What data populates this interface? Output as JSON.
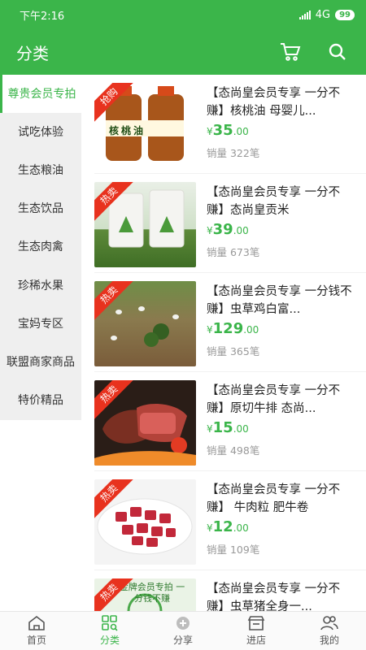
{
  "status": {
    "time": "下午2:16",
    "network": "4G",
    "battery": "99"
  },
  "header": {
    "title": "分类"
  },
  "sidebar": {
    "items": [
      {
        "label": "尊贵会员专拍",
        "active": true
      },
      {
        "label": "试吃体验"
      },
      {
        "label": "生态粮油"
      },
      {
        "label": "生态饮品"
      },
      {
        "label": "生态肉禽"
      },
      {
        "label": "珍稀水果"
      },
      {
        "label": "宝妈专区"
      },
      {
        "label": "联盟商家商品"
      },
      {
        "label": "特价精品"
      }
    ]
  },
  "products": [
    {
      "badge": "抢购",
      "name": "【态尚皇会员专享 一分不赚】核桃油 母婴儿...",
      "currency": "¥",
      "price_int": "35",
      "price_dec": ".00",
      "sales": "销量 322笔",
      "image_label": "核桃油"
    },
    {
      "badge": "热卖",
      "name": "【态尚皇会员专享 一分不赚】态尚皇贡米",
      "currency": "¥",
      "price_int": "39",
      "price_dec": ".00",
      "sales": "销量 673笔"
    },
    {
      "badge": "热卖",
      "name": "【态尚皇会员专享 一分钱不赚】虫草鸡白富...",
      "currency": "¥",
      "price_int": "129",
      "price_dec": ".00",
      "sales": "销量 365笔"
    },
    {
      "badge": "热卖",
      "name": "【态尚皇会员专享 一分不赚】原切牛排 态尚...",
      "currency": "¥",
      "price_int": "15",
      "price_dec": ".00",
      "sales": "销量 498笔"
    },
    {
      "badge": "热卖",
      "name": "【态尚皇会员专享 一分不赚】 牛肉粒 肥牛卷",
      "currency": "¥",
      "price_int": "12",
      "price_dec": ".00",
      "sales": "销量 109笔"
    },
    {
      "badge": "热卖",
      "name": "【态尚皇会员专享 一分不赚】虫草猪全身一...",
      "currency": "¥",
      "price_int": "",
      "price_dec": "",
      "sales": "",
      "image_label": "金牌会员专拍 一分钱不赚"
    }
  ],
  "tabbar": {
    "items": [
      {
        "label": "首页",
        "icon": "home-icon"
      },
      {
        "label": "分类",
        "icon": "category-icon",
        "active": true
      },
      {
        "label": "分享",
        "icon": "share-icon"
      },
      {
        "label": "进店",
        "icon": "store-icon"
      },
      {
        "label": "我的",
        "icon": "profile-icon"
      }
    ]
  },
  "colors": {
    "brand": "#3bb54a",
    "badge": "#e8321e"
  }
}
